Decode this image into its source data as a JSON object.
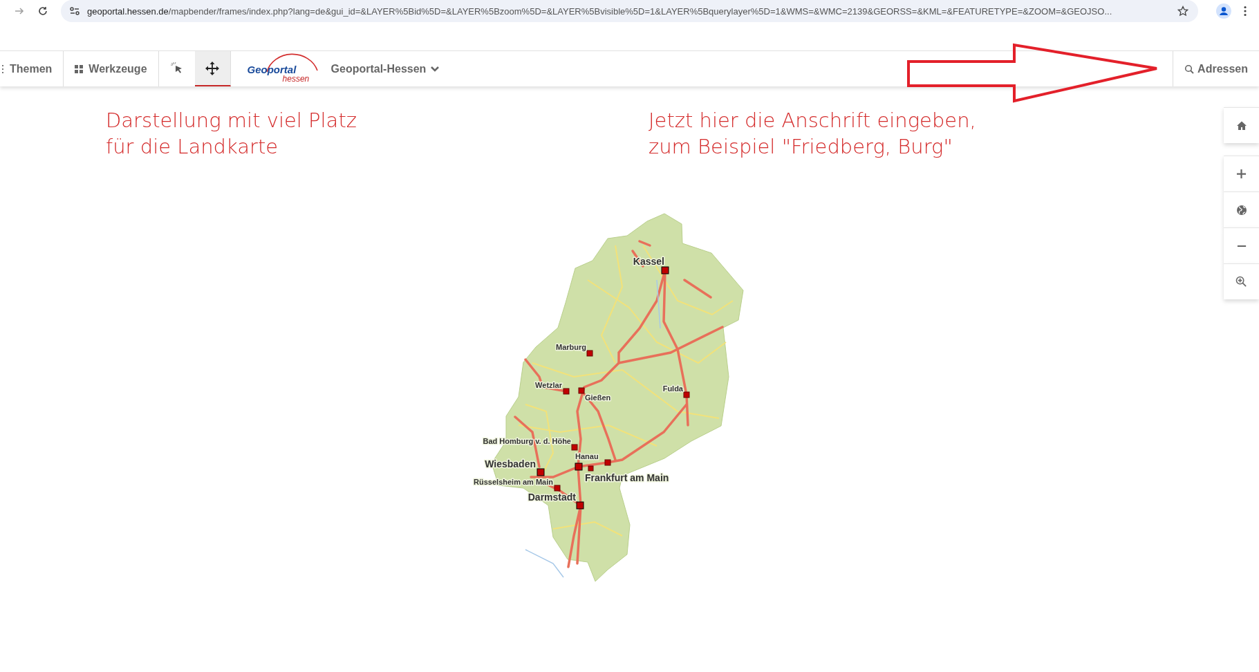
{
  "browser": {
    "back_disabled": true,
    "url": {
      "host": "geoportal.hessen.de",
      "path": "/mapbender/frames/index.php?lang=de&gui_id=&LAYER%5Bid%5D=&LAYER%5Bzoom%5D=&LAYER%5Bvisible%5D=1&LAYER%5Bquerylayer%5D=1&WMS=&WMC=2139&GEORSS=&KML=&FEATURETYPE=&ZOOM=&GEOJSO..."
    }
  },
  "toolbar": {
    "menus": [
      {
        "label": "Themen"
      },
      {
        "label": "Werkzeuge"
      }
    ],
    "tools": [
      {
        "kind": "select",
        "selected": false
      },
      {
        "kind": "pan",
        "selected": true
      }
    ],
    "logo": {
      "title": "Geoportal",
      "subtitle": "hessen"
    },
    "dropdown": {
      "label": "Geoportal-Hessen"
    },
    "search": {
      "label": "Adressen"
    }
  },
  "notes": [
    {
      "text": "Darstellung mit viel Platz\nfür die Landkarte"
    },
    {
      "text": "Jetzt hier die Anschrift eingeben,\nzum Beispiel \"Friedberg, Burg\""
    }
  ],
  "map_controls": [
    {
      "kind": "home"
    },
    {
      "kind": "zoom-in"
    },
    {
      "kind": "globe"
    },
    {
      "kind": "zoom-out"
    },
    {
      "kind": "zoom-box"
    }
  ],
  "cities": [
    {
      "name": "Kassel",
      "kind": "large"
    },
    {
      "name": "Marburg",
      "kind": "small"
    },
    {
      "name": "Wetzlar",
      "kind": "small"
    },
    {
      "name": "Gießen",
      "kind": "small"
    },
    {
      "name": "Fulda",
      "kind": "small"
    },
    {
      "name": "Bad Homburg v. d. Höhe",
      "kind": "small"
    },
    {
      "name": "Hanau",
      "kind": "small"
    },
    {
      "name": "Wiesbaden",
      "kind": "large"
    },
    {
      "name": "Frankfurt am Main",
      "kind": "large"
    },
    {
      "name": "Rüsselsheim am Main",
      "kind": "small"
    },
    {
      "name": "Darmstadt",
      "kind": "large"
    }
  ]
}
